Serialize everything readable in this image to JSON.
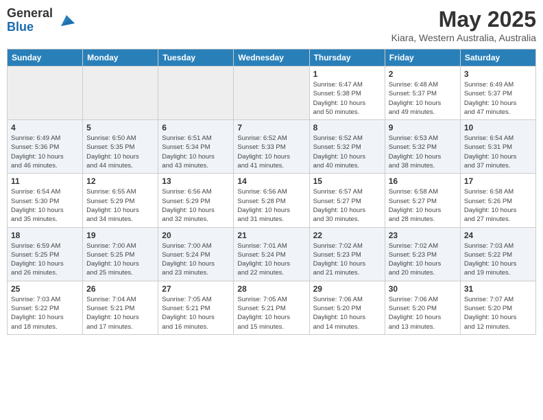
{
  "header": {
    "logo_line1": "General",
    "logo_line2": "Blue",
    "month_year": "May 2025",
    "location": "Kiara, Western Australia, Australia"
  },
  "days_of_week": [
    "Sunday",
    "Monday",
    "Tuesday",
    "Wednesday",
    "Thursday",
    "Friday",
    "Saturday"
  ],
  "weeks": [
    [
      {
        "day": "",
        "info": ""
      },
      {
        "day": "",
        "info": ""
      },
      {
        "day": "",
        "info": ""
      },
      {
        "day": "",
        "info": ""
      },
      {
        "day": "1",
        "info": "Sunrise: 6:47 AM\nSunset: 5:38 PM\nDaylight: 10 hours\nand 50 minutes."
      },
      {
        "day": "2",
        "info": "Sunrise: 6:48 AM\nSunset: 5:37 PM\nDaylight: 10 hours\nand 49 minutes."
      },
      {
        "day": "3",
        "info": "Sunrise: 6:49 AM\nSunset: 5:37 PM\nDaylight: 10 hours\nand 47 minutes."
      }
    ],
    [
      {
        "day": "4",
        "info": "Sunrise: 6:49 AM\nSunset: 5:36 PM\nDaylight: 10 hours\nand 46 minutes."
      },
      {
        "day": "5",
        "info": "Sunrise: 6:50 AM\nSunset: 5:35 PM\nDaylight: 10 hours\nand 44 minutes."
      },
      {
        "day": "6",
        "info": "Sunrise: 6:51 AM\nSunset: 5:34 PM\nDaylight: 10 hours\nand 43 minutes."
      },
      {
        "day": "7",
        "info": "Sunrise: 6:52 AM\nSunset: 5:33 PM\nDaylight: 10 hours\nand 41 minutes."
      },
      {
        "day": "8",
        "info": "Sunrise: 6:52 AM\nSunset: 5:32 PM\nDaylight: 10 hours\nand 40 minutes."
      },
      {
        "day": "9",
        "info": "Sunrise: 6:53 AM\nSunset: 5:32 PM\nDaylight: 10 hours\nand 38 minutes."
      },
      {
        "day": "10",
        "info": "Sunrise: 6:54 AM\nSunset: 5:31 PM\nDaylight: 10 hours\nand 37 minutes."
      }
    ],
    [
      {
        "day": "11",
        "info": "Sunrise: 6:54 AM\nSunset: 5:30 PM\nDaylight: 10 hours\nand 35 minutes."
      },
      {
        "day": "12",
        "info": "Sunrise: 6:55 AM\nSunset: 5:29 PM\nDaylight: 10 hours\nand 34 minutes."
      },
      {
        "day": "13",
        "info": "Sunrise: 6:56 AM\nSunset: 5:29 PM\nDaylight: 10 hours\nand 32 minutes."
      },
      {
        "day": "14",
        "info": "Sunrise: 6:56 AM\nSunset: 5:28 PM\nDaylight: 10 hours\nand 31 minutes."
      },
      {
        "day": "15",
        "info": "Sunrise: 6:57 AM\nSunset: 5:27 PM\nDaylight: 10 hours\nand 30 minutes."
      },
      {
        "day": "16",
        "info": "Sunrise: 6:58 AM\nSunset: 5:27 PM\nDaylight: 10 hours\nand 28 minutes."
      },
      {
        "day": "17",
        "info": "Sunrise: 6:58 AM\nSunset: 5:26 PM\nDaylight: 10 hours\nand 27 minutes."
      }
    ],
    [
      {
        "day": "18",
        "info": "Sunrise: 6:59 AM\nSunset: 5:25 PM\nDaylight: 10 hours\nand 26 minutes."
      },
      {
        "day": "19",
        "info": "Sunrise: 7:00 AM\nSunset: 5:25 PM\nDaylight: 10 hours\nand 25 minutes."
      },
      {
        "day": "20",
        "info": "Sunrise: 7:00 AM\nSunset: 5:24 PM\nDaylight: 10 hours\nand 23 minutes."
      },
      {
        "day": "21",
        "info": "Sunrise: 7:01 AM\nSunset: 5:24 PM\nDaylight: 10 hours\nand 22 minutes."
      },
      {
        "day": "22",
        "info": "Sunrise: 7:02 AM\nSunset: 5:23 PM\nDaylight: 10 hours\nand 21 minutes."
      },
      {
        "day": "23",
        "info": "Sunrise: 7:02 AM\nSunset: 5:23 PM\nDaylight: 10 hours\nand 20 minutes."
      },
      {
        "day": "24",
        "info": "Sunrise: 7:03 AM\nSunset: 5:22 PM\nDaylight: 10 hours\nand 19 minutes."
      }
    ],
    [
      {
        "day": "25",
        "info": "Sunrise: 7:03 AM\nSunset: 5:22 PM\nDaylight: 10 hours\nand 18 minutes."
      },
      {
        "day": "26",
        "info": "Sunrise: 7:04 AM\nSunset: 5:21 PM\nDaylight: 10 hours\nand 17 minutes."
      },
      {
        "day": "27",
        "info": "Sunrise: 7:05 AM\nSunset: 5:21 PM\nDaylight: 10 hours\nand 16 minutes."
      },
      {
        "day": "28",
        "info": "Sunrise: 7:05 AM\nSunset: 5:21 PM\nDaylight: 10 hours\nand 15 minutes."
      },
      {
        "day": "29",
        "info": "Sunrise: 7:06 AM\nSunset: 5:20 PM\nDaylight: 10 hours\nand 14 minutes."
      },
      {
        "day": "30",
        "info": "Sunrise: 7:06 AM\nSunset: 5:20 PM\nDaylight: 10 hours\nand 13 minutes."
      },
      {
        "day": "31",
        "info": "Sunrise: 7:07 AM\nSunset: 5:20 PM\nDaylight: 10 hours\nand 12 minutes."
      }
    ]
  ]
}
